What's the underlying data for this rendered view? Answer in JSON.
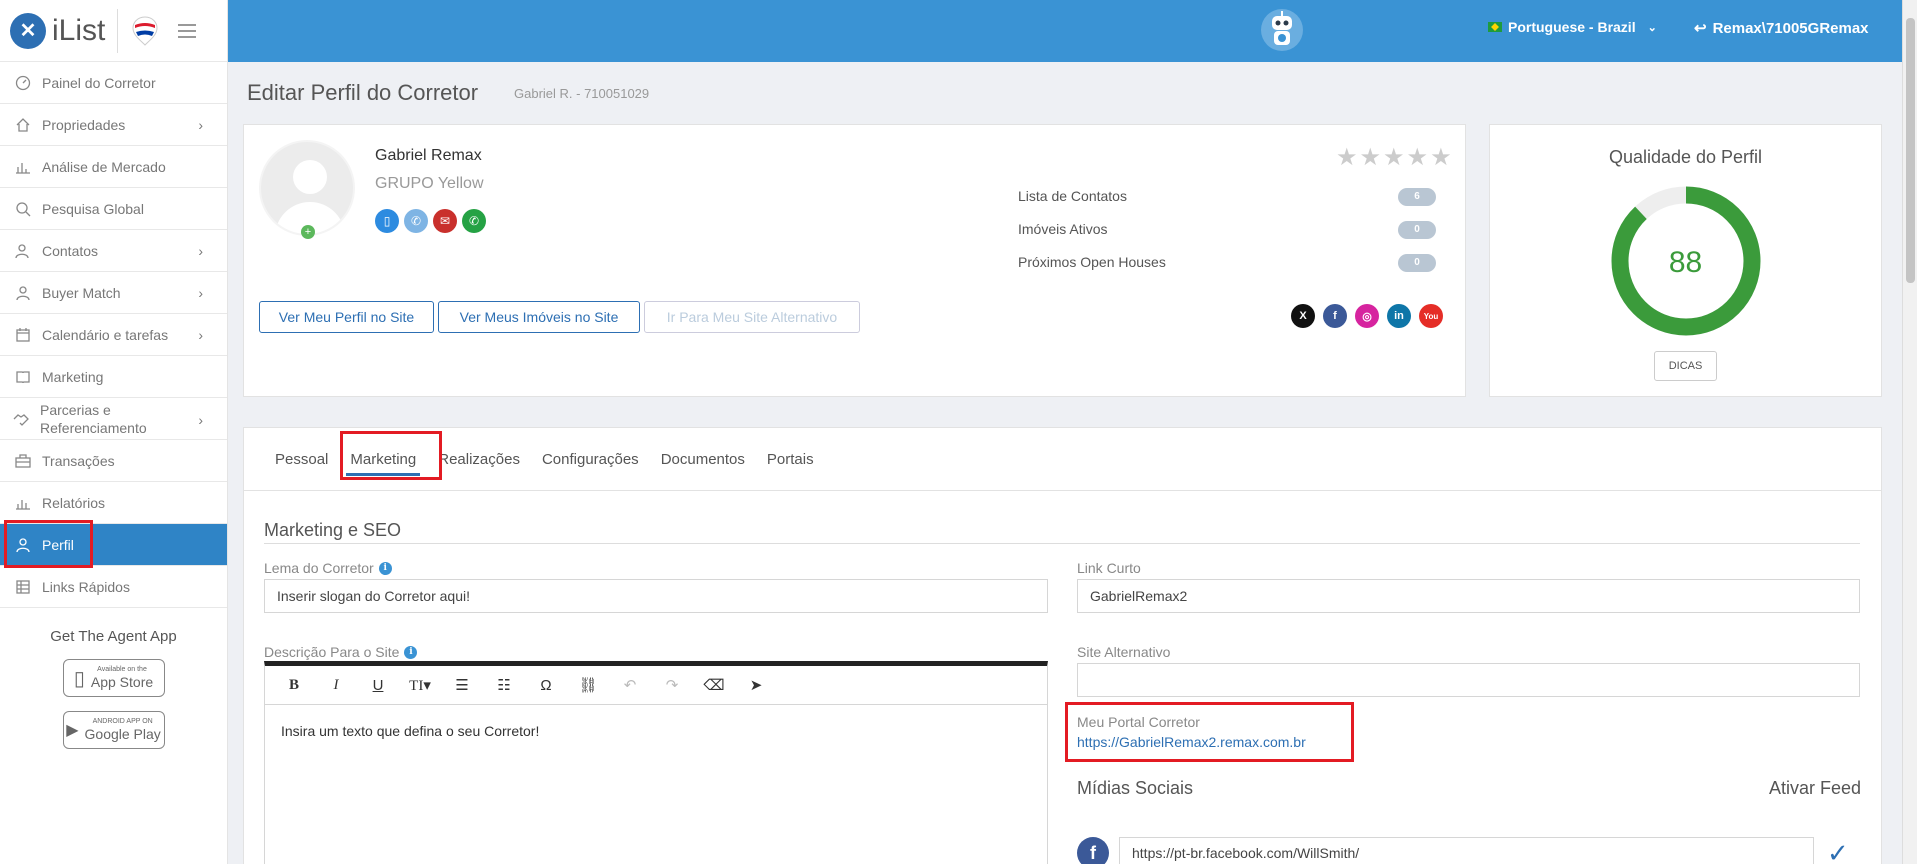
{
  "brand": {
    "name": "iList",
    "remax_label": "RE/MAX"
  },
  "header": {
    "language": "Portuguese - Brazil",
    "user": "Remax\\71005GRemax"
  },
  "sidebar": {
    "items": [
      {
        "label": "Painel do Corretor",
        "icon": "gauge-icon",
        "chevron": false
      },
      {
        "label": "Propriedades",
        "icon": "home-icon",
        "chevron": true
      },
      {
        "label": "Análise de Mercado",
        "icon": "bar-chart-icon",
        "chevron": false
      },
      {
        "label": "Pesquisa Global",
        "icon": "search-icon",
        "chevron": false
      },
      {
        "label": "Contatos",
        "icon": "contacts-icon",
        "chevron": true
      },
      {
        "label": "Buyer Match",
        "icon": "user-icon",
        "chevron": true
      },
      {
        "label": "Calendário e tarefas",
        "icon": "calendar-icon",
        "chevron": true
      },
      {
        "label": "Marketing",
        "icon": "book-icon",
        "chevron": false
      },
      {
        "label": "Parcerias e Referenciamento",
        "icon": "handshake-icon",
        "chevron": true
      },
      {
        "label": "Transações",
        "icon": "briefcase-icon",
        "chevron": false
      },
      {
        "label": "Relatórios",
        "icon": "report-icon",
        "chevron": false
      },
      {
        "label": "Perfil",
        "icon": "profile-icon",
        "chevron": false,
        "active": true
      },
      {
        "label": "Links Rápidos",
        "icon": "links-icon",
        "chevron": false
      }
    ],
    "app_title": "Get The Agent App",
    "app_store": {
      "small": "Available on the",
      "big": "App Store"
    },
    "google_play": {
      "small": "ANDROID APP ON",
      "big": "Google Play"
    }
  },
  "page": {
    "title": "Editar Perfil do Corretor",
    "subtitle": "Gabriel R. - 710051029"
  },
  "profile": {
    "name": "Gabriel Remax",
    "group": "GRUPO Yellow",
    "buttons": {
      "site_profile": "Ver Meu Perfil no Site",
      "site_listings": "Ver Meus Imóveis no Site",
      "alt_site": "Ir Para Meu Site Alternativo"
    },
    "stats": [
      {
        "label": "Lista de Contatos",
        "value": "6"
      },
      {
        "label": "Imóveis Ativos",
        "value": "0"
      },
      {
        "label": "Próximos Open Houses",
        "value": "0"
      }
    ],
    "rating_stars": 0
  },
  "quality": {
    "title": "Qualidade do Perfil",
    "value": "88",
    "percent": 88,
    "tips_label": "DICAS",
    "color": "#3b9b3b"
  },
  "tabs": [
    "Pessoal",
    "Marketing",
    "Realizações",
    "Configurações",
    "Documentos",
    "Portais"
  ],
  "marketing": {
    "section_title": "Marketing e SEO",
    "motto_label": "Lema do Corretor",
    "motto_value": "Inserir slogan do Corretor aqui!",
    "short_link_label": "Link Curto",
    "short_link_value": "GabrielRemax2",
    "description_label": "Descrição Para o Site",
    "description_value": "Insira um texto que defina o seu Corretor!",
    "alt_site_label": "Site Alternativo",
    "alt_site_value": "",
    "portal_label": "Meu Portal Corretor",
    "portal_url": "https://GabrielRemax2.remax.com.br",
    "social_title": "Mídias Sociais",
    "feed_title": "Ativar Feed",
    "facebook_url": "https://pt-br.facebook.com/WillSmith/"
  }
}
